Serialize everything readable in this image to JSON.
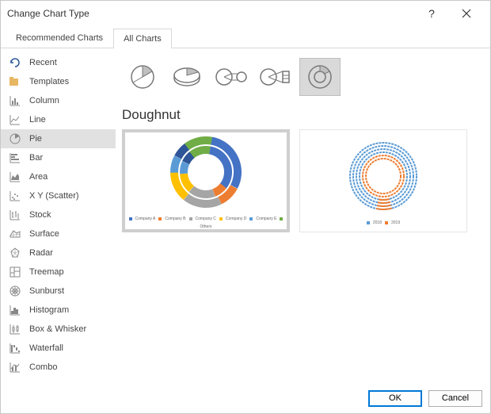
{
  "title": "Change Chart Type",
  "tabs": {
    "recommended": "Recommended Charts",
    "all": "All Charts"
  },
  "sidebar": {
    "items": [
      {
        "label": "Recent"
      },
      {
        "label": "Templates"
      },
      {
        "label": "Column"
      },
      {
        "label": "Line"
      },
      {
        "label": "Pie"
      },
      {
        "label": "Bar"
      },
      {
        "label": "Area"
      },
      {
        "label": "X Y (Scatter)"
      },
      {
        "label": "Stock"
      },
      {
        "label": "Surface"
      },
      {
        "label": "Radar"
      },
      {
        "label": "Treemap"
      },
      {
        "label": "Sunburst"
      },
      {
        "label": "Histogram"
      },
      {
        "label": "Box & Whisker"
      },
      {
        "label": "Waterfall"
      },
      {
        "label": "Combo"
      }
    ]
  },
  "subtype_name": "Doughnut",
  "preview1_legend": [
    "Company A",
    "Company B",
    "Company C",
    "Company D",
    "Company E",
    "Others"
  ],
  "preview2_legend": [
    "2018",
    "2019"
  ],
  "buttons": {
    "ok": "OK",
    "cancel": "Cancel"
  }
}
